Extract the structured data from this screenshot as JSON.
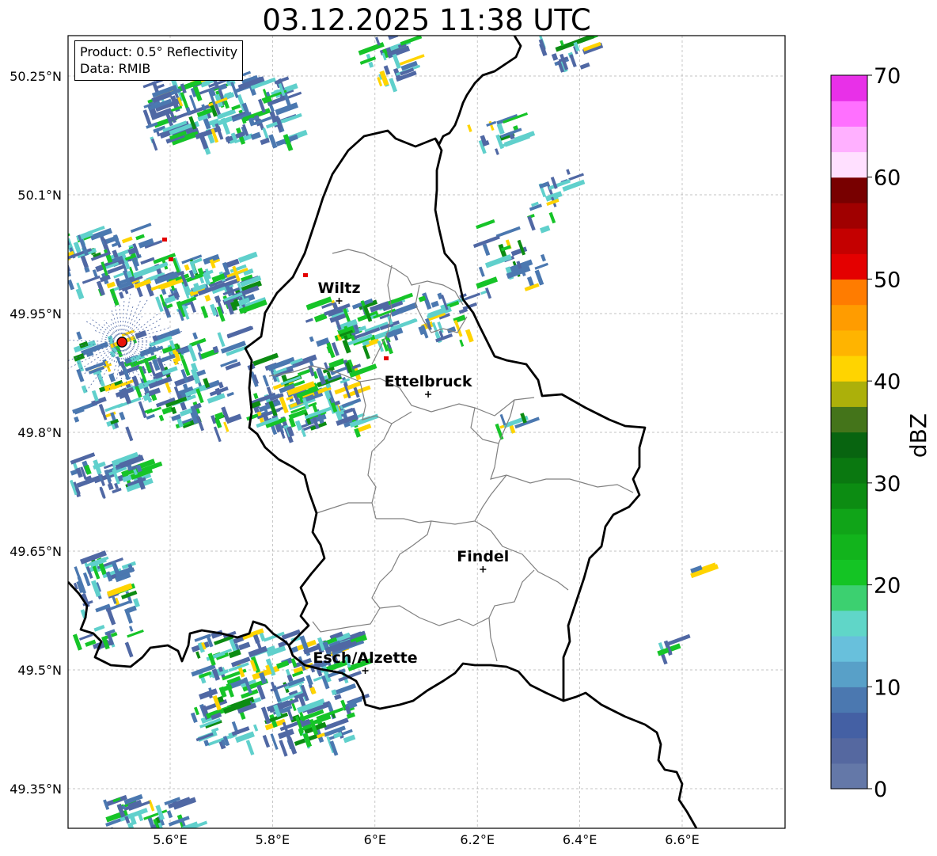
{
  "title": "03.12.2025 11:38 UTC",
  "info": {
    "product": "Product: 0.5° Reflectivity",
    "data": "Data: RMIB"
  },
  "axes": {
    "lon_ticks": [
      "5.6°E",
      "5.8°E",
      "6°E",
      "6.2°E",
      "6.4°E",
      "6.6°E"
    ],
    "lat_ticks": [
      "50.25°N",
      "50.1°N",
      "49.95°N",
      "49.8°N",
      "49.65°N",
      "49.5°N",
      "49.35°N"
    ]
  },
  "cities": [
    {
      "name": "Wiltz",
      "lon": 5.93,
      "lat": 49.966
    },
    {
      "name": "Ettelbruck",
      "lon": 6.104,
      "lat": 49.848
    },
    {
      "name": "Findel",
      "lon": 6.211,
      "lat": 49.627
    },
    {
      "name": "Esch/Alzette",
      "lon": 5.981,
      "lat": 49.499
    }
  ],
  "radar_site": {
    "lon": 5.506,
    "lat": 49.914,
    "color": "#e8140a"
  },
  "colorbar": {
    "label": "dBZ",
    "min": 0,
    "max": 70,
    "step": 2.5,
    "ticks": [
      "0",
      "10",
      "20",
      "30",
      "40",
      "50",
      "60",
      "70"
    ],
    "colors": [
      "#6478a8",
      "#5568a0",
      "#4460a4",
      "#4b78b0",
      "#58a0c8",
      "#68c0dc",
      "#60d6c8",
      "#3cd070",
      "#14c424",
      "#12b41c",
      "#10a418",
      "#0c8c12",
      "#0a7810",
      "#086410",
      "#44741a",
      "#acb00a",
      "#ffd400",
      "#ffb400",
      "#ff9c00",
      "#ff7c00",
      "#e40000",
      "#c40000",
      "#a00000",
      "#780000",
      "#ffe0ff",
      "#ffb0ff",
      "#ff70ff",
      "#e830e8"
    ]
  },
  "echo_colors": {
    "weak": "#5068a4",
    "light": "#4b78b0",
    "cyan": "#60d0cc",
    "green": "#16c428",
    "darkgreen": "#0c8c12",
    "yellow": "#ffd400",
    "red": "#e40000"
  }
}
